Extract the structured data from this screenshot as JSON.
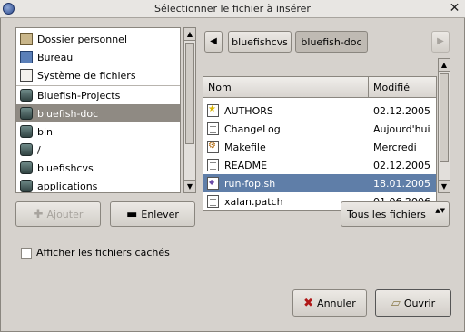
{
  "window": {
    "title": "Sélectionner le fichier à insérer",
    "close_glyph": "✕"
  },
  "places": {
    "items": [
      {
        "label": "Dossier personnel",
        "icon": "home-folder-icon"
      },
      {
        "label": "Bureau",
        "icon": "desktop-icon"
      },
      {
        "label": "Système de fichiers",
        "icon": "filesystem-icon"
      },
      {
        "label": "Bluefish-Projects",
        "icon": "folder-icon"
      },
      {
        "label": "bluefish-doc",
        "icon": "folder-icon",
        "selected": true
      },
      {
        "label": "bin",
        "icon": "folder-icon"
      },
      {
        "label": "/",
        "icon": "folder-icon"
      },
      {
        "label": "bluefishcvs",
        "icon": "folder-icon"
      },
      {
        "label": "applications",
        "icon": "folder-icon"
      }
    ],
    "add_label": "Ajouter",
    "remove_label": "Enlever"
  },
  "pathbar": {
    "back_glyph": "◀",
    "forward_glyph": "▶",
    "segments": [
      "bluefishcvs",
      "bluefish-doc"
    ]
  },
  "files": {
    "columns": {
      "name": "Nom",
      "modified": "Modifié"
    },
    "sort_glyph": "▼",
    "rows": [
      {
        "name": "AUTHORS",
        "modified": "02.12.2005",
        "icon": "star-file-icon"
      },
      {
        "name": "ChangeLog",
        "modified": "Aujourd'hui",
        "icon": "text-file-icon"
      },
      {
        "name": "Makefile",
        "modified": "Mercredi",
        "icon": "makefile-icon"
      },
      {
        "name": "README",
        "modified": "02.12.2005",
        "icon": "text-file-icon"
      },
      {
        "name": "run-fop.sh",
        "modified": "18.01.2005",
        "icon": "script-file-icon",
        "selected": true
      },
      {
        "name": "xalan.patch",
        "modified": "01.06.2006",
        "icon": "text-file-icon"
      }
    ]
  },
  "filter": {
    "selected": "Tous les fichiers",
    "arrows": "▲▼"
  },
  "show_hidden": {
    "label": "Afficher les fichiers cachés",
    "checked": false
  },
  "actions": {
    "cancel_label": "Annuler",
    "open_label": "Ouvrir"
  },
  "scroll_glyphs": {
    "up": "▲",
    "down": "▼"
  },
  "colors": {
    "selection_places": "#8f8a83",
    "selection_files": "#5f7ea8",
    "background": "#d6d2cd"
  }
}
